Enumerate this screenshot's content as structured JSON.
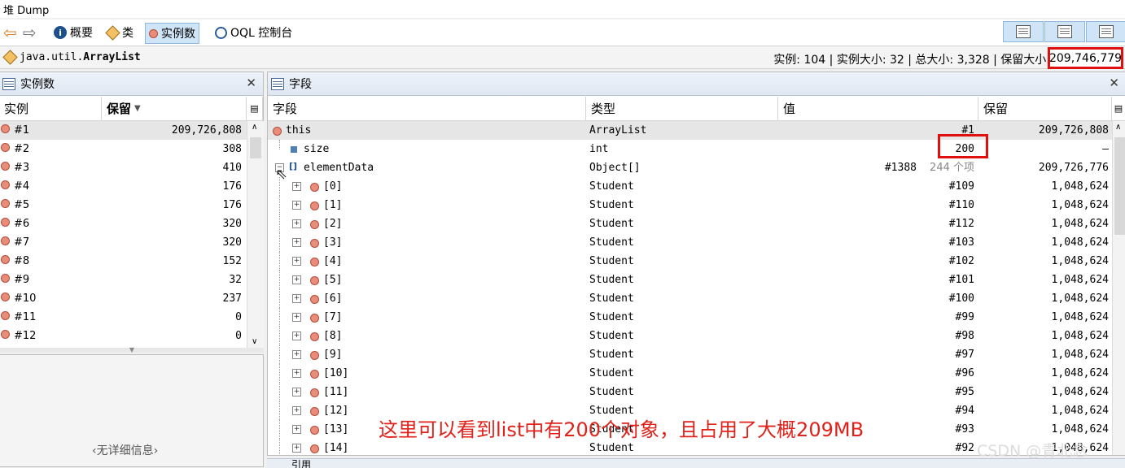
{
  "window": {
    "title": "堆 Dump"
  },
  "toolbar": {
    "summary_label": "概要",
    "classes_label": "类",
    "instances_label": "实例数",
    "oql_label": "OQL 控制台"
  },
  "classbar": {
    "package": "java.util.",
    "class": "ArrayList",
    "stats": "实例: 104 | 实例大小: 32 | 总大小: 3,328 | 保留大小:",
    "retained_value": "209,746,779"
  },
  "instances_panel": {
    "title": "实例数",
    "col_instance": "实例",
    "col_retained": "保留",
    "rows": [
      {
        "id": "#1",
        "retained": "209,726,808"
      },
      {
        "id": "#2",
        "retained": "308"
      },
      {
        "id": "#3",
        "retained": "410"
      },
      {
        "id": "#4",
        "retained": "176"
      },
      {
        "id": "#5",
        "retained": "176"
      },
      {
        "id": "#6",
        "retained": "320"
      },
      {
        "id": "#7",
        "retained": "320"
      },
      {
        "id": "#8",
        "retained": "152"
      },
      {
        "id": "#9",
        "retained": "32"
      },
      {
        "id": "#10",
        "retained": "237"
      },
      {
        "id": "#11",
        "retained": "0"
      },
      {
        "id": "#12",
        "retained": "0"
      }
    ],
    "empty_detail": "‹无详细信息›"
  },
  "fields_panel": {
    "title": "字段",
    "col_field": "字段",
    "col_type": "类型",
    "col_value": "值",
    "col_retained": "保留",
    "rows": [
      {
        "name": "this",
        "type": "ArrayList",
        "value": "#1",
        "count": "",
        "retained": "209,726,808",
        "kind": "obj",
        "indent": 0
      },
      {
        "name": "size",
        "type": "int",
        "value": "200",
        "count": "",
        "retained": "–",
        "kind": "prim",
        "indent": 1
      },
      {
        "name": "elementData",
        "type": "Object[]",
        "value": "#1388",
        "count": "244 个项",
        "retained": "209,726,776",
        "kind": "arr",
        "indent": 0
      },
      {
        "name": "[0]",
        "type": "Student",
        "value": "#109",
        "count": "",
        "retained": "1,048,624",
        "kind": "item",
        "indent": 1
      },
      {
        "name": "[1]",
        "type": "Student",
        "value": "#110",
        "count": "",
        "retained": "1,048,624",
        "kind": "item",
        "indent": 1
      },
      {
        "name": "[2]",
        "type": "Student",
        "value": "#112",
        "count": "",
        "retained": "1,048,624",
        "kind": "item",
        "indent": 1
      },
      {
        "name": "[3]",
        "type": "Student",
        "value": "#103",
        "count": "",
        "retained": "1,048,624",
        "kind": "item",
        "indent": 1
      },
      {
        "name": "[4]",
        "type": "Student",
        "value": "#102",
        "count": "",
        "retained": "1,048,624",
        "kind": "item",
        "indent": 1
      },
      {
        "name": "[5]",
        "type": "Student",
        "value": "#101",
        "count": "",
        "retained": "1,048,624",
        "kind": "item",
        "indent": 1
      },
      {
        "name": "[6]",
        "type": "Student",
        "value": "#100",
        "count": "",
        "retained": "1,048,624",
        "kind": "item",
        "indent": 1
      },
      {
        "name": "[7]",
        "type": "Student",
        "value": "#99",
        "count": "",
        "retained": "1,048,624",
        "kind": "item",
        "indent": 1
      },
      {
        "name": "[8]",
        "type": "Student",
        "value": "#98",
        "count": "",
        "retained": "1,048,624",
        "kind": "item",
        "indent": 1
      },
      {
        "name": "[9]",
        "type": "Student",
        "value": "#97",
        "count": "",
        "retained": "1,048,624",
        "kind": "item",
        "indent": 1
      },
      {
        "name": "[10]",
        "type": "Student",
        "value": "#96",
        "count": "",
        "retained": "1,048,624",
        "kind": "item",
        "indent": 1
      },
      {
        "name": "[11]",
        "type": "Student",
        "value": "#95",
        "count": "",
        "retained": "1,048,624",
        "kind": "item",
        "indent": 1
      },
      {
        "name": "[12]",
        "type": "Student",
        "value": "#94",
        "count": "",
        "retained": "1,048,624",
        "kind": "item",
        "indent": 1
      },
      {
        "name": "[13]",
        "type": "Student",
        "value": "#93",
        "count": "",
        "retained": "1,048,624",
        "kind": "item",
        "indent": 1
      },
      {
        "name": "[14]",
        "type": "Student",
        "value": "#92",
        "count": "",
        "retained": "1,048,624",
        "kind": "item",
        "indent": 1
      }
    ]
  },
  "bottom_tab": {
    "label": "引用"
  },
  "annotation": {
    "caption": "这里可以看到list中有200个对象，且占用了大概209MB",
    "color": "#e0221a"
  },
  "watermark": "CSDN @青北念",
  "colors": {
    "highlight": "#e01010",
    "selected_tab": "#cfe4f6"
  }
}
